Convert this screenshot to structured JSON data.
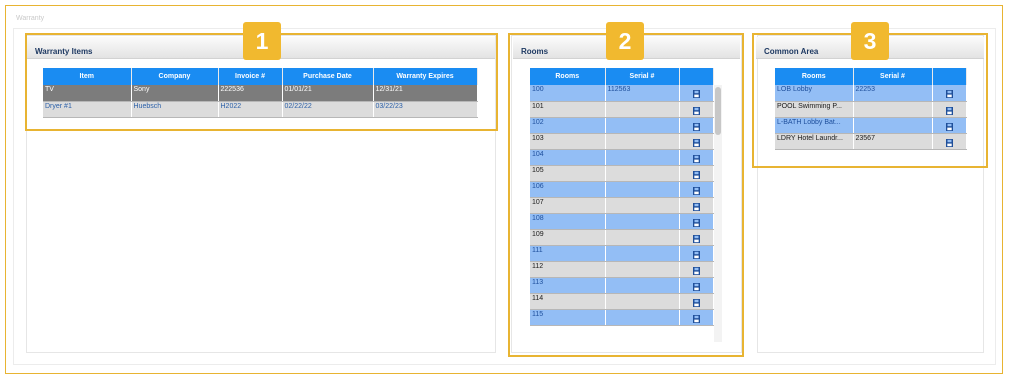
{
  "window": {
    "title": "Warranty"
  },
  "panels": {
    "warranty": {
      "badge": "1",
      "title": "Warranty Items",
      "columns": [
        "Item",
        "Company",
        "Invoice #",
        "Purchase Date",
        "Warranty Expires"
      ],
      "rows": [
        [
          "TV",
          "Sony",
          "222536",
          "01/01/21",
          "12/31/21"
        ],
        [
          "Dryer #1",
          "Huebsch",
          "H2022",
          "02/22/22",
          "03/22/23"
        ]
      ]
    },
    "rooms": {
      "badge": "2",
      "title": "Rooms",
      "columns": [
        "Rooms",
        "Serial #",
        ""
      ],
      "rows": [
        [
          "100",
          "112563"
        ],
        [
          "101",
          ""
        ],
        [
          "102",
          ""
        ],
        [
          "103",
          ""
        ],
        [
          "104",
          ""
        ],
        [
          "105",
          ""
        ],
        [
          "106",
          ""
        ],
        [
          "107",
          ""
        ],
        [
          "108",
          ""
        ],
        [
          "109",
          ""
        ],
        [
          "111",
          ""
        ],
        [
          "112",
          ""
        ],
        [
          "113",
          ""
        ],
        [
          "114",
          ""
        ],
        [
          "115",
          ""
        ]
      ],
      "row_icon": "save-icon"
    },
    "common": {
      "badge": "3",
      "title": "Common Area",
      "columns": [
        "Rooms",
        "Serial #",
        ""
      ],
      "rows": [
        [
          "LOB Lobby",
          "22253"
        ],
        [
          "POOL Swimming P...",
          ""
        ],
        [
          "L-BATH Lobby Bat...",
          ""
        ],
        [
          "LDRY Hotel Laundr...",
          "23567"
        ]
      ],
      "row_icon": "save-icon"
    }
  },
  "colors": {
    "accent": "#e8b432",
    "header": "#1a8cf2",
    "row_blue": "#93bef5",
    "row_gray": "#dcdcdc",
    "selected": "#7c7c7c"
  }
}
